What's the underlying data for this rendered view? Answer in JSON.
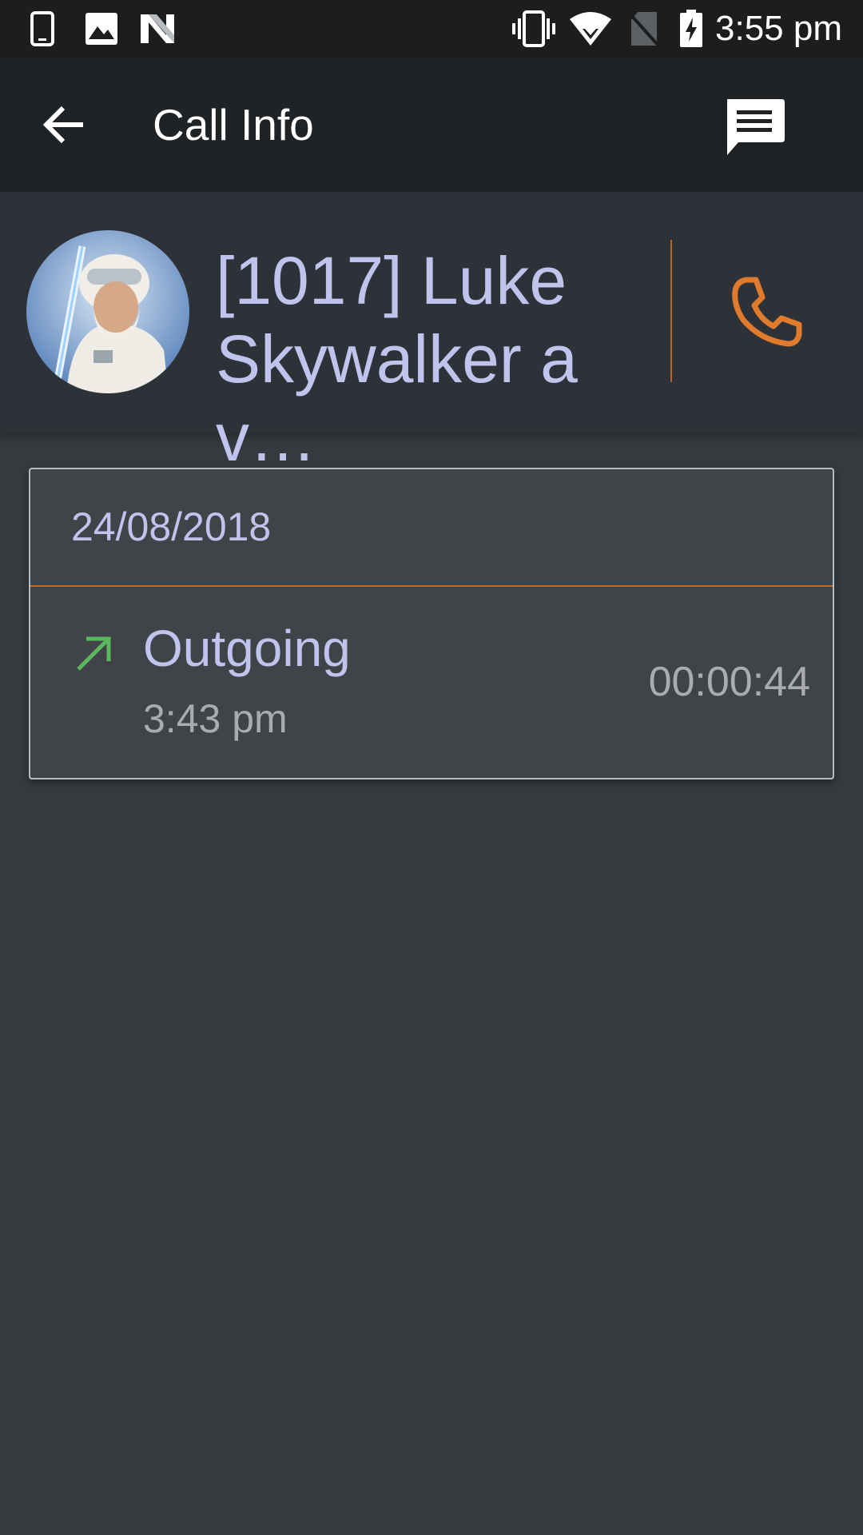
{
  "status_bar": {
    "time": "3:55 pm",
    "left_icons": [
      "phone-icon",
      "image-icon",
      "n-icon"
    ],
    "right_icons": [
      "vibrate-icon",
      "wifi-icon",
      "no-sim-icon",
      "battery-charging-icon"
    ]
  },
  "app_bar": {
    "title": "Call Info",
    "back_icon": "arrow-back-icon",
    "message_icon": "message-icon"
  },
  "contact": {
    "name": "[1017] Luke\nSkywalker a v…",
    "avatar_icon": "avatar",
    "call_icon": "phone-call-icon"
  },
  "call_log": {
    "date": "24/08/2018",
    "entries": [
      {
        "type": "Outgoing",
        "time": "3:43 pm",
        "duration": "00:00:44",
        "direction_icon": "outgoing-arrow-icon"
      }
    ]
  },
  "colors": {
    "accent": "#e07b2e",
    "text_primary": "#c0c3ec",
    "text_secondary": "#a9abae",
    "outgoing_arrow": "#5cb85c",
    "background": "#363a3f"
  }
}
